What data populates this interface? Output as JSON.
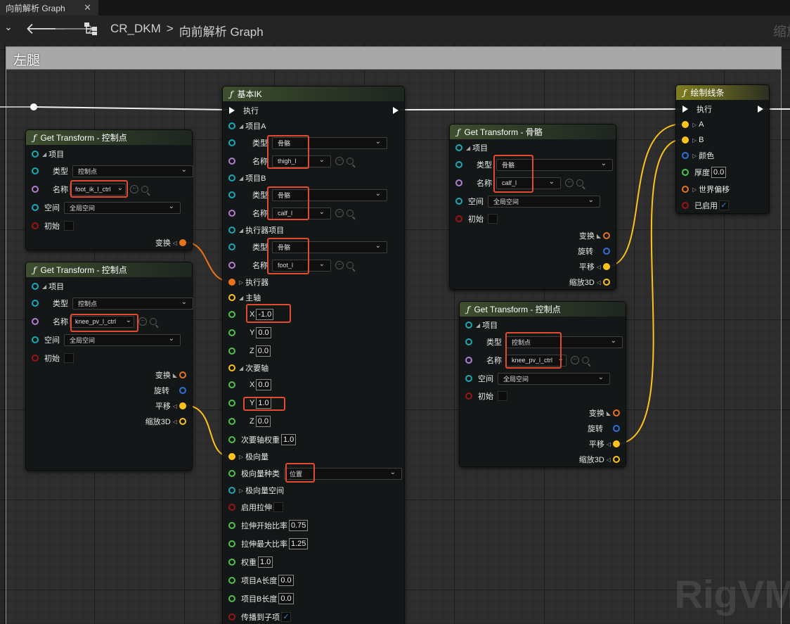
{
  "tab": {
    "title": "向前解析 Graph",
    "close": "✕"
  },
  "toolbar": {
    "breadcrumb": [
      "CR_DKM",
      "向前解析 Graph"
    ],
    "separator": ">",
    "zoom_label": "缩放"
  },
  "comment": {
    "title": "左腿"
  },
  "watermark": "RigVM",
  "colors": {
    "exec": "#ffffff",
    "struct": "#1aa8b8",
    "name": "#b47cd1",
    "bool": "#9b1414",
    "transform": "#e8731c",
    "vector": "#ffc21a",
    "float": "#4ec44e",
    "rotator": "#2e6fd6",
    "highlight": "#e44b2c"
  },
  "nodes": {
    "gt1": {
      "title": "Get Transform - 控制点",
      "item": "项目",
      "type_label": "类型",
      "type_value": "控制点",
      "name_label": "名称",
      "name_value": "foot_ik_l_ctrl",
      "space_label": "空间",
      "space_value": "全局空间",
      "initial_label": "初始",
      "transform_label": "变换"
    },
    "gt2": {
      "title": "Get Transform - 控制点",
      "item": "项目",
      "type_label": "类型",
      "type_value": "控制点",
      "name_label": "名称",
      "name_value": "knee_pv_l_ctrl",
      "space_label": "空间",
      "space_value": "全局空间",
      "initial_label": "初始",
      "transform_label": "变换",
      "rotation_label": "旋转",
      "translation_label": "平移",
      "scale_label": "缩放3D"
    },
    "ik": {
      "title": "基本IK",
      "exec": "执行",
      "itemA": "项目A",
      "itemB": "项目B",
      "effector_item": "执行器项目",
      "type_label": "类型",
      "name_label": "名称",
      "itemA_type": "骨骼",
      "itemA_name": "thigh_l",
      "itemB_type": "骨骼",
      "itemB_name": "calf_l",
      "eff_type": "骨骼",
      "eff_name": "foot_l",
      "effector": "执行器",
      "primary_axis": "主轴",
      "px_label": "X",
      "px": "-1.0",
      "py_label": "Y",
      "py": "0.0",
      "pz_label": "Z",
      "pz": "0.0",
      "secondary_axis": "次要轴",
      "sx_label": "X",
      "sx": "0.0",
      "sy_label": "Y",
      "sy": "1.0",
      "sz_label": "Z",
      "sz": "0.0",
      "secondary_weight_label": "次要轴权重",
      "secondary_weight": "1.0",
      "pole": "极向量",
      "pole_kind_label": "极向量种类",
      "pole_kind": "位置",
      "pole_space": "极向量空间",
      "enable_stretch": "启用拉伸",
      "stretch_start_label": "拉伸开始比率",
      "stretch_start": "0.75",
      "stretch_max_label": "拉伸最大比率",
      "stretch_max": "1.25",
      "weight_label": "权重",
      "weight": "1.0",
      "lenA_label": "项目A长度",
      "lenA": "0.0",
      "lenB_label": "项目B长度",
      "lenB": "0.0",
      "propagate": "传播到子项",
      "propagate_check": "✓"
    },
    "gtb": {
      "title": "Get Transform - 骨骼",
      "item": "项目",
      "type_label": "类型",
      "type_value": "骨骼",
      "name_label": "名称",
      "name_value": "calf_l",
      "space_label": "空间",
      "space_value": "全局空间",
      "initial_label": "初始",
      "transform_label": "变换",
      "rotation_label": "旋转",
      "translation_label": "平移",
      "scale_label": "缩放3D"
    },
    "gt3": {
      "title": "Get Transform - 控制点",
      "item": "项目",
      "type_label": "类型",
      "type_value": "控制点",
      "name_label": "名称",
      "name_value": "knee_pv_l_ctrl",
      "space_label": "空间",
      "space_value": "全局空间",
      "initial_label": "初始",
      "transform_label": "变换",
      "rotation_label": "旋转",
      "translation_label": "平移",
      "scale_label": "缩放3D"
    },
    "draw": {
      "title": "绘制线条",
      "exec": "执行",
      "a": "A",
      "b": "B",
      "color": "颜色",
      "thickness_label": "厚度",
      "thickness": "0.0",
      "offset": "世界偏移",
      "enabled": "已启用",
      "enabled_check": "✓"
    }
  }
}
